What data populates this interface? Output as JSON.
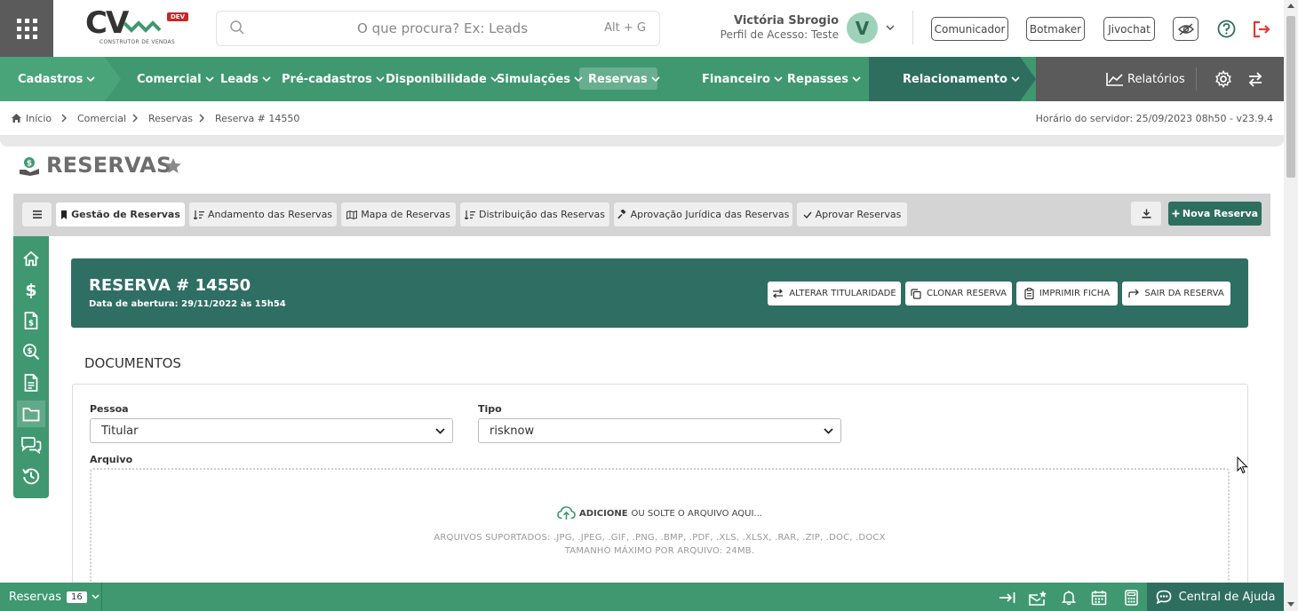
{
  "header": {
    "logo_text": "CV",
    "logo_badge": "DEV",
    "logo_sub": "CONSTRUTOR DE VENDAS",
    "search_placeholder": "O que procura? Ex: Leads",
    "search_shortcut": "Alt + G",
    "user_name": "Victória Sbrogio",
    "user_role": "Perfil de Acesso: Teste",
    "avatar_letter": "V",
    "buttons": [
      "Comunicador",
      "Botmaker",
      "Jivochat"
    ]
  },
  "nav": {
    "items": [
      "Cadastros",
      "Comercial",
      "Leads",
      "Pré-cadastros",
      "Disponibilidade",
      "Simulações",
      "Reservas",
      "Financeiro",
      "Repasses",
      "Relacionamento",
      "Relatórios"
    ],
    "active": "Reservas"
  },
  "breadcrumb": {
    "items": [
      "Início",
      "Comercial",
      "Reservas",
      "Reserva # 14550"
    ],
    "server_time": "Horário do servidor: 25/09/2023 08h50 - v23.9.4"
  },
  "page": {
    "title": "RESERVAS"
  },
  "tabs": {
    "items": [
      "Gestão de Reservas",
      "Andamento das Reservas",
      "Mapa de Reservas",
      "Distribuição das Reservas",
      "Aprovação Jurídica das Reservas",
      "Aprovar Reservas"
    ],
    "active": "Gestão de Reservas",
    "new_button": "Nova Reserva"
  },
  "reserva": {
    "title": "RESERVA # 14550",
    "subtitle": "Data de abertura: 29/11/2022 às 15h54",
    "actions": [
      "ALTERAR TITULARIDADE",
      "CLONAR RESERVA",
      "IMPRIMIR FICHA",
      "SAIR DA RESERVA"
    ]
  },
  "documentos": {
    "section_title": "DOCUMENTOS",
    "pessoa_label": "Pessoa",
    "pessoa_value": "Titular",
    "tipo_label": "Tipo",
    "tipo_value": "risknow",
    "arquivo_label": "Arquivo",
    "dropzone_bold": "ADICIONE",
    "dropzone_text": "OU SOLTE O ARQUIVO AQUI...",
    "supported": "ARQUIVOS SUPORTADOS: .JPG, .JPEG, .GIF, .PNG, .BMP, .PDF, .XLS, .XLSX, .RAR, .ZIP, .DOC, .DOCX",
    "max_size": "TAMANHO MÁXIMO POR ARQUIVO: 24MB."
  },
  "footer": {
    "context_label": "Reservas",
    "context_count": "16",
    "help_label": "Central de Ajuda"
  },
  "colors": {
    "brand_green": "#3f9870",
    "dark_green": "#2e6e63",
    "danger": "#e53935"
  }
}
